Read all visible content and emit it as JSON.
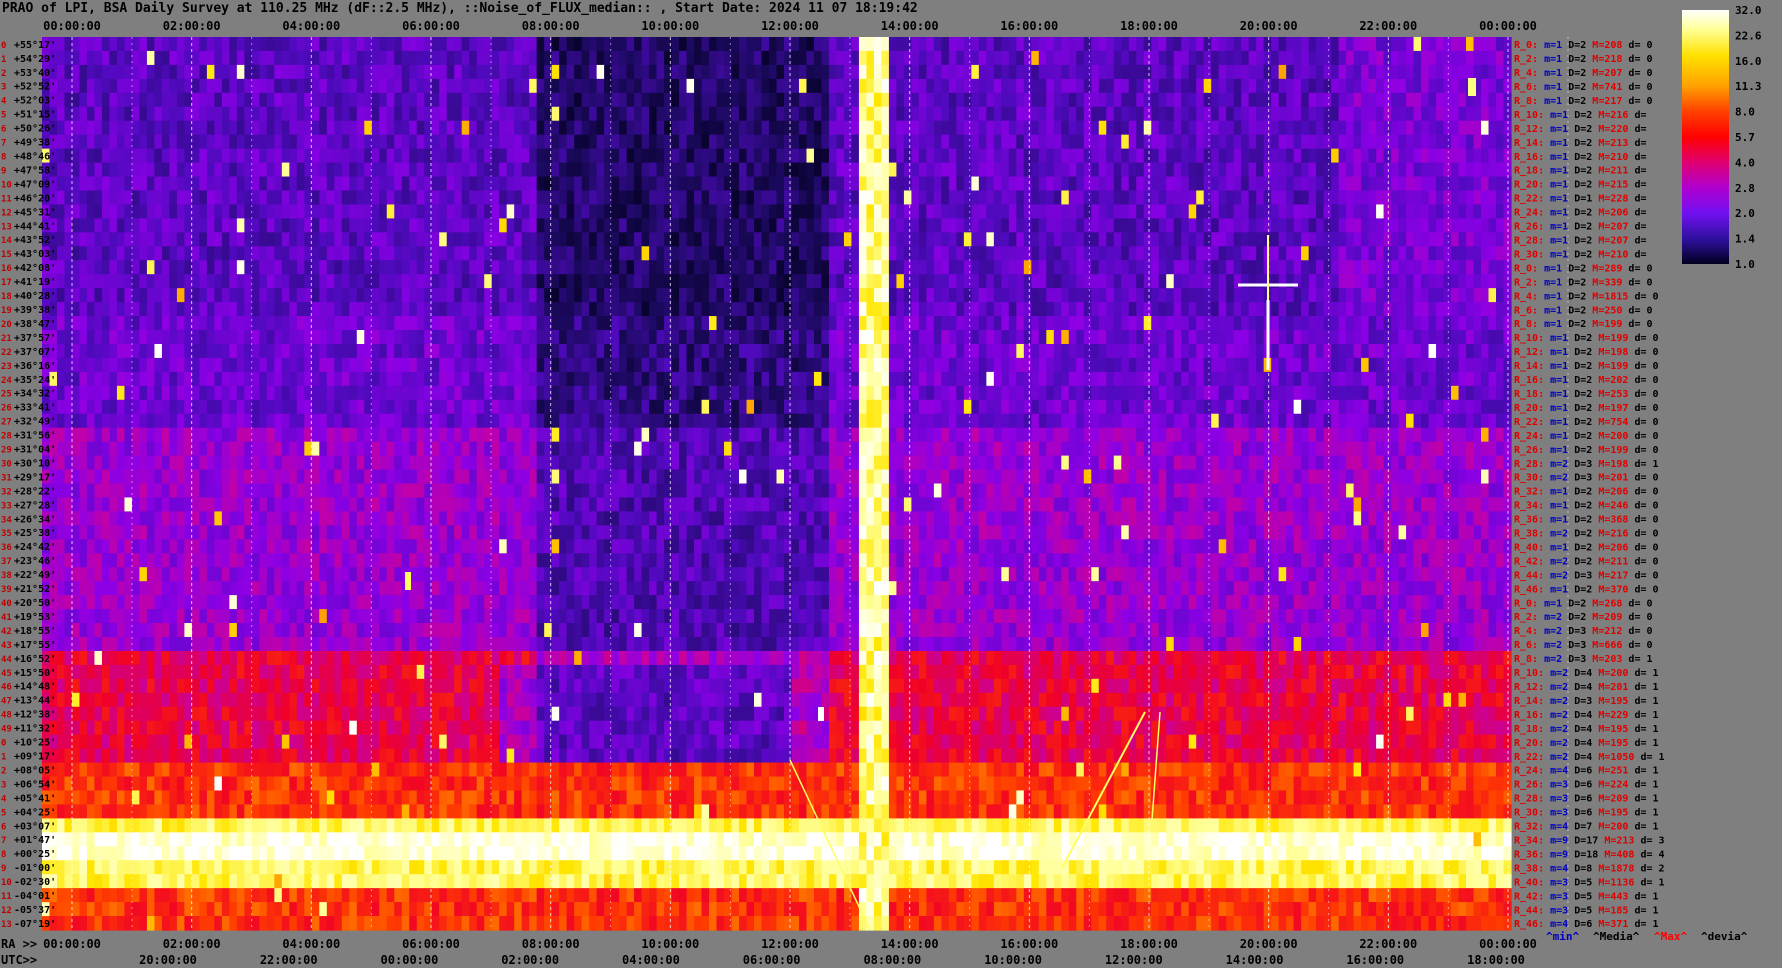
{
  "title": "PRAO of LPI, BSA Daily Survey at 110.25 MHz (dF::2.5 MHz), ::Noise_of_FLUX_median:: , Start Date: 2024 11 07 18:19:42",
  "chart_data": {
    "type": "heatmap",
    "top_ticks": [
      "00:00:00",
      "02:00:00",
      "04:00:00",
      "06:00:00",
      "08:00:00",
      "10:00:00",
      "12:00:00",
      "14:00:00",
      "16:00:00",
      "18:00:00",
      "20:00:00",
      "22:00:00",
      "00:00:00"
    ],
    "ra_label": "RA >>",
    "ra_ticks": [
      "00:00:00",
      "02:00:00",
      "04:00:00",
      "06:00:00",
      "08:00:00",
      "10:00:00",
      "12:00:00",
      "14:00:00",
      "16:00:00",
      "18:00:00",
      "20:00:00",
      "22:00:00",
      "00:00:00"
    ],
    "utc_label": "UTC>>",
    "utc_ticks": [
      "20:00:00",
      "22:00:00",
      "00:00:00",
      "02:00:00",
      "04:00:00",
      "06:00:00",
      "08:00:00",
      "10:00:00",
      "12:00:00",
      "14:00:00",
      "16:00:00",
      "18:00:00"
    ],
    "dec_labels": [
      "+55°17'",
      "+54°29'",
      "+53°40'",
      "+52°52'",
      "+52°03'",
      "+51°15'",
      "+50°26'",
      "+49°38'",
      "+48°46'",
      "+47°58'",
      "+47°09'",
      "+46°20'",
      "+45°31'",
      "+44°41'",
      "+43°52'",
      "+43°03'",
      "+42°08'",
      "+41°19'",
      "+40°28'",
      "+39°38'",
      "+38°47'",
      "+37°57'",
      "+37°07'",
      "+36°16'",
      "+35°24'",
      "+34°32'",
      "+33°41'",
      "+32°49'",
      "+31°56'",
      "+31°04'",
      "+30°10'",
      "+29°17'",
      "+28°22'",
      "+27°28'",
      "+26°34'",
      "+25°38'",
      "+24°42'",
      "+23°46'",
      "+22°49'",
      "+21°52'",
      "+20°50'",
      "+19°53'",
      "+18°55'",
      "+17°55'",
      "+16°52'",
      "+15°50'",
      "+14°48'",
      "+13°44'",
      "+12°38'",
      "+11°32'",
      "+10°25'",
      "+09°17'",
      "+08°05'",
      "+06°54'",
      "+05°41'",
      "+04°25'",
      "+03°07'",
      "+01°47'",
      "+00°25'",
      "-01°00'",
      "-02°30'",
      "-04°01'",
      "-05°37'",
      "-07°19'"
    ],
    "colorbar": {
      "ticks": [
        "32.0",
        "22.6",
        "16.0",
        "11.3",
        "8.0",
        "5.7",
        "4.0",
        "2.8",
        "2.0",
        "1.4",
        "1.0"
      ],
      "colors": [
        "#ffffff",
        "#ffff80",
        "#ffe000",
        "#ffa000",
        "#ff4000",
        "#ff0000",
        "#e00060",
        "#c000c0",
        "#8000ff",
        "#4010a0",
        "#000020"
      ]
    },
    "receivers": [
      {
        "r": "R_0:",
        "m": "m=1",
        "d": "D=2",
        "M": "M=208",
        "dev": "d= 0"
      },
      {
        "r": "R_2:",
        "m": "m=1",
        "d": "D=2",
        "M": "M=218",
        "dev": "d= 0"
      },
      {
        "r": "R_4:",
        "m": "m=1",
        "d": "D=2",
        "M": "M=207",
        "dev": "d= 0"
      },
      {
        "r": "R_6:",
        "m": "m=1",
        "d": "D=2",
        "M": "M=741",
        "dev": "d= 0"
      },
      {
        "r": "R_8:",
        "m": "m=1",
        "d": "D=2",
        "M": "M=217",
        "dev": "d= 0"
      },
      {
        "r": "R_10:",
        "m": "m=1",
        "d": "D=2",
        "M": "M=216",
        "dev": "d="
      },
      {
        "r": "R_12:",
        "m": "m=1",
        "d": "D=2",
        "M": "M=220",
        "dev": "d="
      },
      {
        "r": "R_14:",
        "m": "m=1",
        "d": "D=2",
        "M": "M=213",
        "dev": "d="
      },
      {
        "r": "R_16:",
        "m": "m=1",
        "d": "D=2",
        "M": "M=210",
        "dev": "d="
      },
      {
        "r": "R_18:",
        "m": "m=1",
        "d": "D=2",
        "M": "M=211",
        "dev": "d="
      },
      {
        "r": "R_20:",
        "m": "m=1",
        "d": "D=2",
        "M": "M=215",
        "dev": "d="
      },
      {
        "r": "R_22:",
        "m": "m=1",
        "d": "D=1",
        "M": "M=228",
        "dev": "d="
      },
      {
        "r": "R_24:",
        "m": "m=1",
        "d": "D=2",
        "M": "M=206",
        "dev": "d="
      },
      {
        "r": "R_26:",
        "m": "m=1",
        "d": "D=2",
        "M": "M=207",
        "dev": "d="
      },
      {
        "r": "R_28:",
        "m": "m=1",
        "d": "D=2",
        "M": "M=207",
        "dev": "d="
      },
      {
        "r": "R_30:",
        "m": "m=1",
        "d": "D=2",
        "M": "M=210",
        "dev": "d="
      },
      {
        "r": "R_0:",
        "m": "m=1",
        "d": "D=2",
        "M": "M=289",
        "dev": "d= 0"
      },
      {
        "r": "R_2:",
        "m": "m=1",
        "d": "D=2",
        "M": "M=339",
        "dev": "d= 0"
      },
      {
        "r": "R_4:",
        "m": "m=1",
        "d": "D=2",
        "M": "M=1815",
        "dev": "d= 0"
      },
      {
        "r": "R_6:",
        "m": "m=1",
        "d": "D=2",
        "M": "M=250",
        "dev": "d= 0"
      },
      {
        "r": "R_8:",
        "m": "m=1",
        "d": "D=2",
        "M": "M=199",
        "dev": "d= 0"
      },
      {
        "r": "R_10:",
        "m": "m=1",
        "d": "D=2",
        "M": "M=199",
        "dev": "d= 0"
      },
      {
        "r": "R_12:",
        "m": "m=1",
        "d": "D=2",
        "M": "M=198",
        "dev": "d= 0"
      },
      {
        "r": "R_14:",
        "m": "m=1",
        "d": "D=2",
        "M": "M=199",
        "dev": "d= 0"
      },
      {
        "r": "R_16:",
        "m": "m=1",
        "d": "D=2",
        "M": "M=202",
        "dev": "d= 0"
      },
      {
        "r": "R_18:",
        "m": "m=1",
        "d": "D=2",
        "M": "M=253",
        "dev": "d= 0"
      },
      {
        "r": "R_20:",
        "m": "m=1",
        "d": "D=2",
        "M": "M=197",
        "dev": "d= 0"
      },
      {
        "r": "R_22:",
        "m": "m=1",
        "d": "D=2",
        "M": "M=754",
        "dev": "d= 0"
      },
      {
        "r": "R_24:",
        "m": "m=1",
        "d": "D=2",
        "M": "M=200",
        "dev": "d= 0"
      },
      {
        "r": "R_26:",
        "m": "m=1",
        "d": "D=2",
        "M": "M=199",
        "dev": "d= 0"
      },
      {
        "r": "R_28:",
        "m": "m=2",
        "d": "D=3",
        "M": "M=198",
        "dev": "d= 1"
      },
      {
        "r": "R_30:",
        "m": "m=2",
        "d": "D=3",
        "M": "M=201",
        "dev": "d= 0"
      },
      {
        "r": "R_32:",
        "m": "m=1",
        "d": "D=2",
        "M": "M=206",
        "dev": "d= 0"
      },
      {
        "r": "R_34:",
        "m": "m=1",
        "d": "D=2",
        "M": "M=246",
        "dev": "d= 0"
      },
      {
        "r": "R_36:",
        "m": "m=1",
        "d": "D=2",
        "M": "M=368",
        "dev": "d= 0"
      },
      {
        "r": "R_38:",
        "m": "m=2",
        "d": "D=2",
        "M": "M=216",
        "dev": "d= 0"
      },
      {
        "r": "R_40:",
        "m": "m=1",
        "d": "D=2",
        "M": "M=206",
        "dev": "d= 0"
      },
      {
        "r": "R_42:",
        "m": "m=2",
        "d": "D=2",
        "M": "M=211",
        "dev": "d= 0"
      },
      {
        "r": "R_44:",
        "m": "m=2",
        "d": "D=3",
        "M": "M=217",
        "dev": "d= 0"
      },
      {
        "r": "R_46:",
        "m": "m=1",
        "d": "D=2",
        "M": "M=370",
        "dev": "d= 0"
      },
      {
        "r": "R_0:",
        "m": "m=1",
        "d": "D=2",
        "M": "M=268",
        "dev": "d= 0"
      },
      {
        "r": "R_2:",
        "m": "m=2",
        "d": "D=2",
        "M": "M=209",
        "dev": "d= 0"
      },
      {
        "r": "R_4:",
        "m": "m=2",
        "d": "D=3",
        "M": "M=212",
        "dev": "d= 0"
      },
      {
        "r": "R_6:",
        "m": "m=2",
        "d": "D=3",
        "M": "M=666",
        "dev": "d= 0"
      },
      {
        "r": "R_8:",
        "m": "m=2",
        "d": "D=3",
        "M": "M=203",
        "dev": "d= 1"
      },
      {
        "r": "R_10:",
        "m": "m=2",
        "d": "D=4",
        "M": "M=200",
        "dev": "d= 1"
      },
      {
        "r": "R_12:",
        "m": "m=2",
        "d": "D=4",
        "M": "M=201",
        "dev": "d= 1"
      },
      {
        "r": "R_14:",
        "m": "m=2",
        "d": "D=3",
        "M": "M=195",
        "dev": "d= 1"
      },
      {
        "r": "R_16:",
        "m": "m=2",
        "d": "D=4",
        "M": "M=229",
        "dev": "d= 1"
      },
      {
        "r": "R_18:",
        "m": "m=2",
        "d": "D=4",
        "M": "M=195",
        "dev": "d= 1"
      },
      {
        "r": "R_20:",
        "m": "m=2",
        "d": "D=4",
        "M": "M=195",
        "dev": "d= 1"
      },
      {
        "r": "R_22:",
        "m": "m=2",
        "d": "D=4",
        "M": "M=1050",
        "dev": "d= 1"
      },
      {
        "r": "R_24:",
        "m": "m=4",
        "d": "D=6",
        "M": "M=251",
        "dev": "d= 1"
      },
      {
        "r": "R_26:",
        "m": "m=3",
        "d": "D=6",
        "M": "M=224",
        "dev": "d= 1"
      },
      {
        "r": "R_28:",
        "m": "m=3",
        "d": "D=6",
        "M": "M=209",
        "dev": "d= 1"
      },
      {
        "r": "R_30:",
        "m": "m=3",
        "d": "D=6",
        "M": "M=195",
        "dev": "d= 1"
      },
      {
        "r": "R_32:",
        "m": "m=4",
        "d": "D=7",
        "M": "M=200",
        "dev": "d= 1"
      },
      {
        "r": "R_34:",
        "m": "m=9",
        "d": "D=17",
        "M": "M=213",
        "dev": "d= 3"
      },
      {
        "r": "R_36:",
        "m": "m=9",
        "d": "D=18",
        "M": "M=408",
        "dev": "d= 4"
      },
      {
        "r": "R_38:",
        "m": "m=4",
        "d": "D=8",
        "M": "M=1878",
        "dev": "d= 2"
      },
      {
        "r": "R_40:",
        "m": "m=3",
        "d": "D=5",
        "M": "M=1136",
        "dev": "d= 1"
      },
      {
        "r": "R_42:",
        "m": "m=3",
        "d": "D=5",
        "M": "M=443",
        "dev": "d= 1"
      },
      {
        "r": "R_44:",
        "m": "m=3",
        "d": "D=5",
        "M": "M=185",
        "dev": "d= 1"
      },
      {
        "r": "R_46:",
        "m": "m=4",
        "d": "D=6",
        "M": "M=371",
        "dev": "d= 1"
      }
    ],
    "footer_legend": [
      {
        "text": "^min^",
        "color": "#0000c0"
      },
      {
        "text": "^Media^",
        "color": "#000000"
      },
      {
        "text": "^Max^",
        "color": "#ff0000"
      },
      {
        "text": "^devia^",
        "color": "#000000"
      }
    ]
  }
}
